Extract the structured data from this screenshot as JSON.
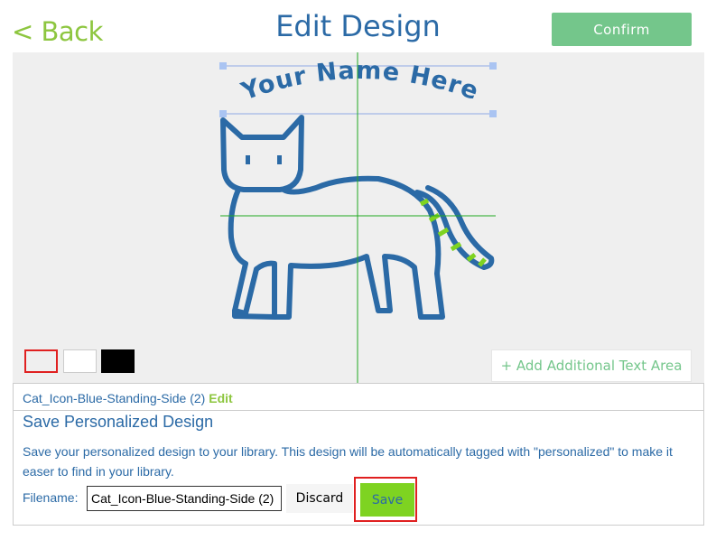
{
  "header": {
    "back_label": "< Back",
    "title": "Edit Design",
    "confirm_label": "Confirm"
  },
  "canvas": {
    "curved_text": "Your Name Here",
    "design_icon": "cat-standing-side-icon",
    "add_text_label": "+ Add Additional Text Area",
    "swatches": [
      {
        "name": "transparent",
        "color": "#efefef",
        "selected": true
      },
      {
        "name": "white",
        "color": "#ffffff",
        "selected": false
      },
      {
        "name": "black",
        "color": "#000000",
        "selected": false
      }
    ]
  },
  "panel": {
    "design_name": "Cat_Icon-Blue-Standing-Side (2)",
    "edit_label": "Edit",
    "section_title": "Save Personalized Design",
    "description": "Save your personalized design to your library. This design will be automatically tagged with \"personalized\" to make it easer to find in your library.",
    "filename_label": "Filename:",
    "filename_value": "Cat_Icon-Blue-Standing-Side (2)",
    "discard_label": "Discard",
    "save_label": "Save"
  },
  "colors": {
    "brand_blue": "#2b6aa6",
    "accent_green": "#8dc63f",
    "confirm_green": "#74c68b",
    "save_green": "#7ed321",
    "highlight_red": "#e02020"
  }
}
